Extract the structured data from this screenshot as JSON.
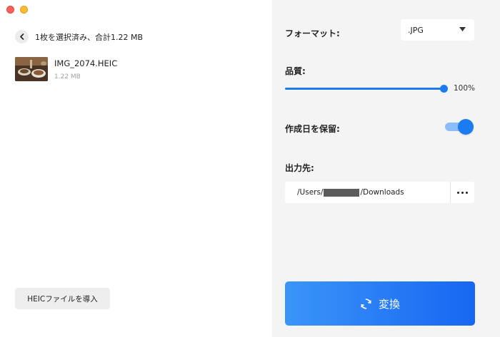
{
  "window": {
    "controls": [
      "close",
      "minimize"
    ]
  },
  "left_pane": {
    "back_icon": "chevron-left-icon",
    "selection_summary": "1枚を選択済み、合計1.22 MB",
    "files": [
      {
        "name": "IMG_2074.HEIC",
        "size": "1.22 MB"
      }
    ],
    "import_button": "HEICファイルを導入"
  },
  "right_pane": {
    "format": {
      "label": "フォーマット:",
      "selected": ".JPG"
    },
    "quality": {
      "label": "品質:",
      "value_text": "100%",
      "level": 1.0
    },
    "keep_date": {
      "label": "作成日を保留:",
      "enabled": true
    },
    "output": {
      "label": "出力先:",
      "path_prefix": "/Users/",
      "path_suffix": "/Downloads",
      "path_redacted": true
    },
    "convert_button": "変換",
    "colors": {
      "accent": "#1a7cf0",
      "panel_bg": "#f4f4f4",
      "button_gradient_start": "#3a95f8",
      "button_gradient_end": "#1866f2"
    }
  }
}
